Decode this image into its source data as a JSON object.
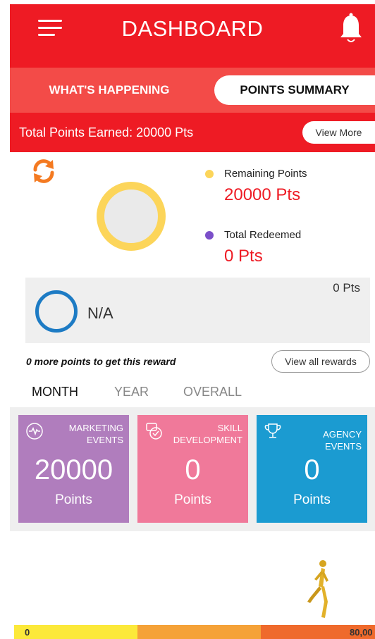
{
  "header": {
    "title": "DASHBOARD"
  },
  "tabs": [
    {
      "label": "WHAT'S HAPPENING",
      "active": false
    },
    {
      "label": "POINTS SUMMARY",
      "active": true
    }
  ],
  "total": {
    "text": "Total Points Earned: 20000 Pts",
    "button": "View More"
  },
  "summary": {
    "remaining_label": "Remaining Points",
    "remaining_value": "20000 Pts",
    "redeemed_label": "Total Redeemed",
    "redeemed_value": "0 Pts",
    "colors": {
      "remaining": "#fcd55a",
      "redeemed": "#7b4fc9"
    }
  },
  "reward": {
    "name": "N/A",
    "points": "0 Pts",
    "more_points_text": "0 more points to get this reward",
    "view_all_label": "View all rewards"
  },
  "periods": [
    {
      "label": "MONTH",
      "active": true
    },
    {
      "label": "YEAR",
      "active": false
    },
    {
      "label": "OVERALL",
      "active": false
    }
  ],
  "categories": [
    {
      "title": "MARKETING EVENTS",
      "value": "20000",
      "unit": "Points",
      "color": "#b07dbd",
      "icon": "heartbeat-icon"
    },
    {
      "title": "SKILL DEVELOPMENT",
      "value": "0",
      "unit": "Points",
      "color": "#f0799a",
      "icon": "badge-check-icon"
    },
    {
      "title": "AGENCY EVENTS",
      "value": "0",
      "unit": "Points",
      "color": "#1b9bd1",
      "icon": "trophy-icon"
    }
  ],
  "progress": {
    "start_label": "0",
    "end_label": "80,00",
    "colors": [
      "#fce93a",
      "#f5a238",
      "#ef6a2c"
    ]
  }
}
